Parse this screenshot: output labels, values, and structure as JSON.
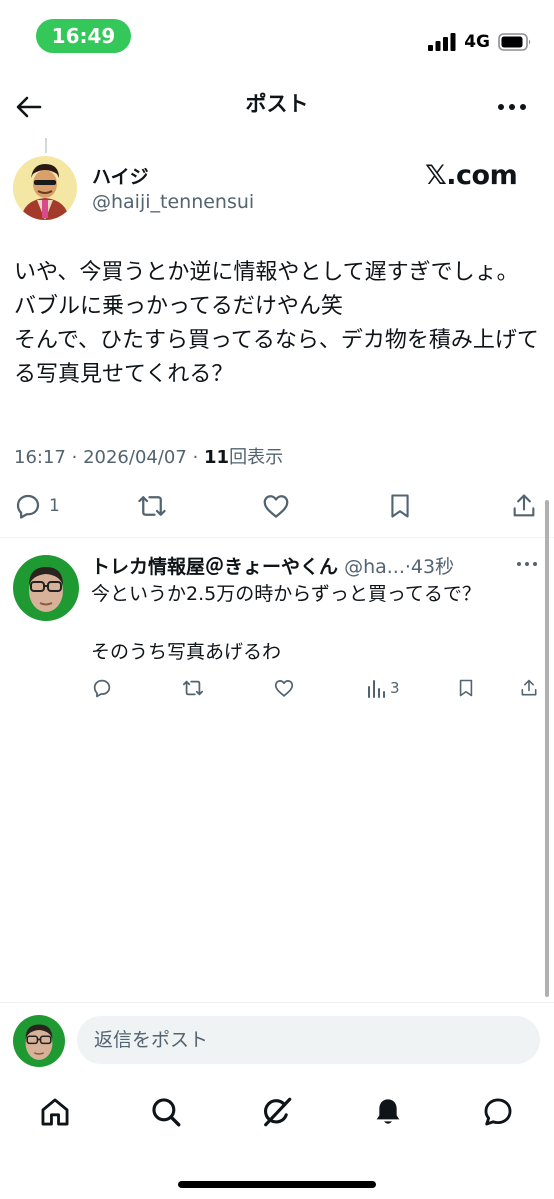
{
  "status_bar": {
    "time": "16:49",
    "network": "4G"
  },
  "header": {
    "title": "ポスト"
  },
  "post": {
    "author_name": "ハイジ",
    "author_handle": "@haiji_tennensui",
    "source_badge": "𝕏.com",
    "text": "いや、今買うとか逆に情報やとして遅すぎでしょ。バブルに乗っかってるだけやん笑\nそんで、ひたすら買ってるなら、デカ物を積み上げてる写真見せてくれる？",
    "time": "16:17",
    "date": "2026/04/07",
    "separator": "·",
    "views": "11",
    "views_label": "回表示",
    "reply_count": "1"
  },
  "reply": {
    "author_name": "トレカ情報屋＠きょーやくん",
    "author_handle": "@ha...",
    "separator": "·",
    "age": "43秒",
    "text": "今というか2.5万の時からずっと買ってるで？\n\nそのうち写真あげるわ",
    "views": "3"
  },
  "composer": {
    "placeholder": "返信をポスト"
  },
  "colors": {
    "status_green": "#34c759",
    "text_primary": "#0f1419",
    "text_secondary": "#536471",
    "divider": "#eff3f4",
    "input_bg": "#eff3f4"
  },
  "icons": {
    "header": [
      "back-arrow-icon",
      "more-horizontal-icon"
    ],
    "post_actions": [
      "reply-icon",
      "repost-icon",
      "like-icon",
      "bookmark-icon",
      "share-icon"
    ],
    "reply_actions": [
      "reply-icon",
      "repost-icon",
      "like-icon",
      "views-icon",
      "bookmark-icon",
      "share-icon"
    ],
    "bottom_nav": [
      "home-icon",
      "search-icon",
      "grok-icon",
      "notifications-icon",
      "messages-icon"
    ]
  }
}
